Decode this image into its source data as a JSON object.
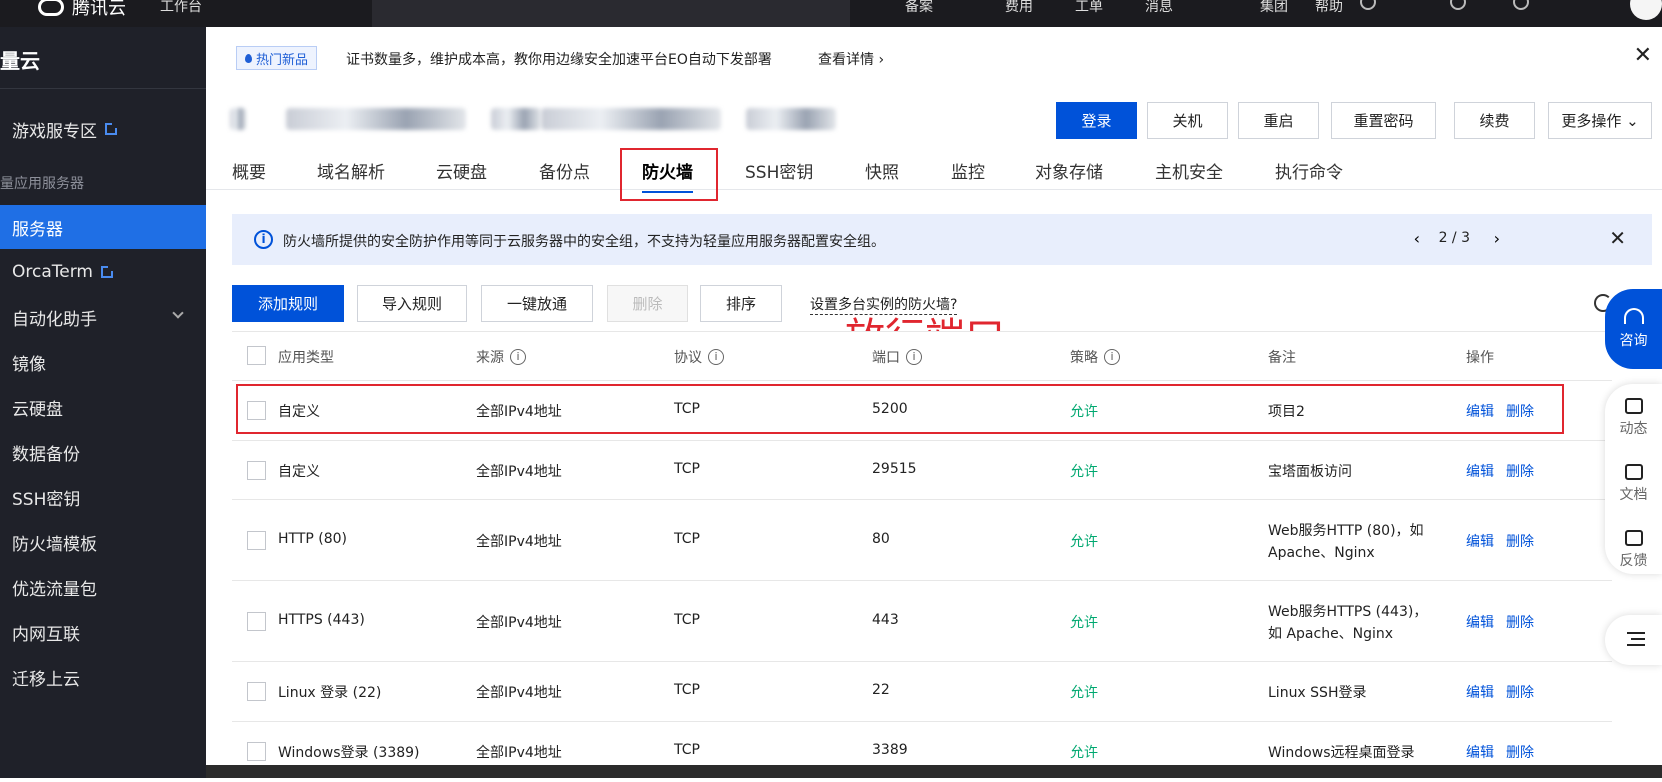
{
  "topbar": {
    "brand": "腾讯云",
    "nav1": "工作台",
    "items": [
      "备案",
      "费用",
      "工单",
      "消息",
      "集团",
      "帮助"
    ]
  },
  "sidebar": {
    "brand": "量云",
    "items": [
      {
        "label": "游戏服专区",
        "external": true
      },
      {
        "label": "服务器",
        "active": true
      },
      {
        "label": "OrcaTerm",
        "external": true
      },
      {
        "label": "自动化助手",
        "expand": true
      },
      {
        "label": "镜像"
      },
      {
        "label": "云硬盘"
      },
      {
        "label": "数据备份"
      },
      {
        "label": "SSH密钥"
      },
      {
        "label": "防火墙模板"
      },
      {
        "label": "优选流量包"
      },
      {
        "label": "内网互联"
      },
      {
        "label": "迁移上云"
      }
    ],
    "group_label": "量应用服务器"
  },
  "notice": {
    "tag": "热门新品",
    "message": "证书数量多，维护成本高，教你用边缘安全加速平台EO自动下发部署",
    "more": "查看详情"
  },
  "instance_actions": [
    "登录",
    "关机",
    "重启",
    "重置密码",
    "续费",
    "更多操作"
  ],
  "tabs": [
    "概要",
    "域名解析",
    "云硬盘",
    "备份点",
    "防火墙",
    "SSH密钥",
    "快照",
    "监控",
    "对象存储",
    "主机安全",
    "执行命令"
  ],
  "active_tab": "防火墙",
  "info": {
    "text": "防火墙所提供的安全防护作用等同于云服务器中的安全组，不支持为轻量应用服务器配置安全组。",
    "pager": "2 / 3"
  },
  "toolbar": {
    "add": "添加规则",
    "import": "导入规则",
    "open_all": "一键放通",
    "delete": "删除",
    "sort": "排序",
    "multi_link": "设置多台实例的防火墙?"
  },
  "annotation": "放行端口",
  "table": {
    "headers": [
      "应用类型",
      "来源",
      "协议",
      "端口",
      "策略",
      "备注",
      "操作"
    ],
    "rows": [
      {
        "type": "自定义",
        "source": "全部IPv4地址",
        "protocol": "TCP",
        "port": "5200",
        "policy": "允许",
        "remark": [
          "项目2"
        ],
        "edit": "编辑",
        "del": "删除"
      },
      {
        "type": "自定义",
        "source": "全部IPv4地址",
        "protocol": "TCP",
        "port": "29515",
        "policy": "允许",
        "remark": [
          "宝塔面板访问"
        ],
        "edit": "编辑",
        "del": "删除"
      },
      {
        "type": "HTTP (80)",
        "source": "全部IPv4地址",
        "protocol": "TCP",
        "port": "80",
        "policy": "允许",
        "remark": [
          "Web服务HTTP (80)，如",
          "Apache、Nginx"
        ],
        "edit": "编辑",
        "del": "删除"
      },
      {
        "type": "HTTPS (443)",
        "source": "全部IPv4地址",
        "protocol": "TCP",
        "port": "443",
        "policy": "允许",
        "remark": [
          "Web服务HTTPS (443)，",
          "如 Apache、Nginx"
        ],
        "edit": "编辑",
        "del": "删除"
      },
      {
        "type": "Linux 登录 (22)",
        "source": "全部IPv4地址",
        "protocol": "TCP",
        "port": "22",
        "policy": "允许",
        "remark": [
          "Linux SSH登录"
        ],
        "edit": "编辑",
        "del": "删除"
      },
      {
        "type": "Windows登录 (3389)",
        "source": "全部IPv4地址",
        "protocol": "TCP",
        "port": "3389",
        "policy": "允许",
        "remark": [
          "Windows远程桌面登录"
        ],
        "edit": "编辑",
        "del": "删除"
      }
    ]
  },
  "float": {
    "consult": "咨询",
    "dynamic": "动态",
    "docs": "文档",
    "feedback": "反馈"
  }
}
